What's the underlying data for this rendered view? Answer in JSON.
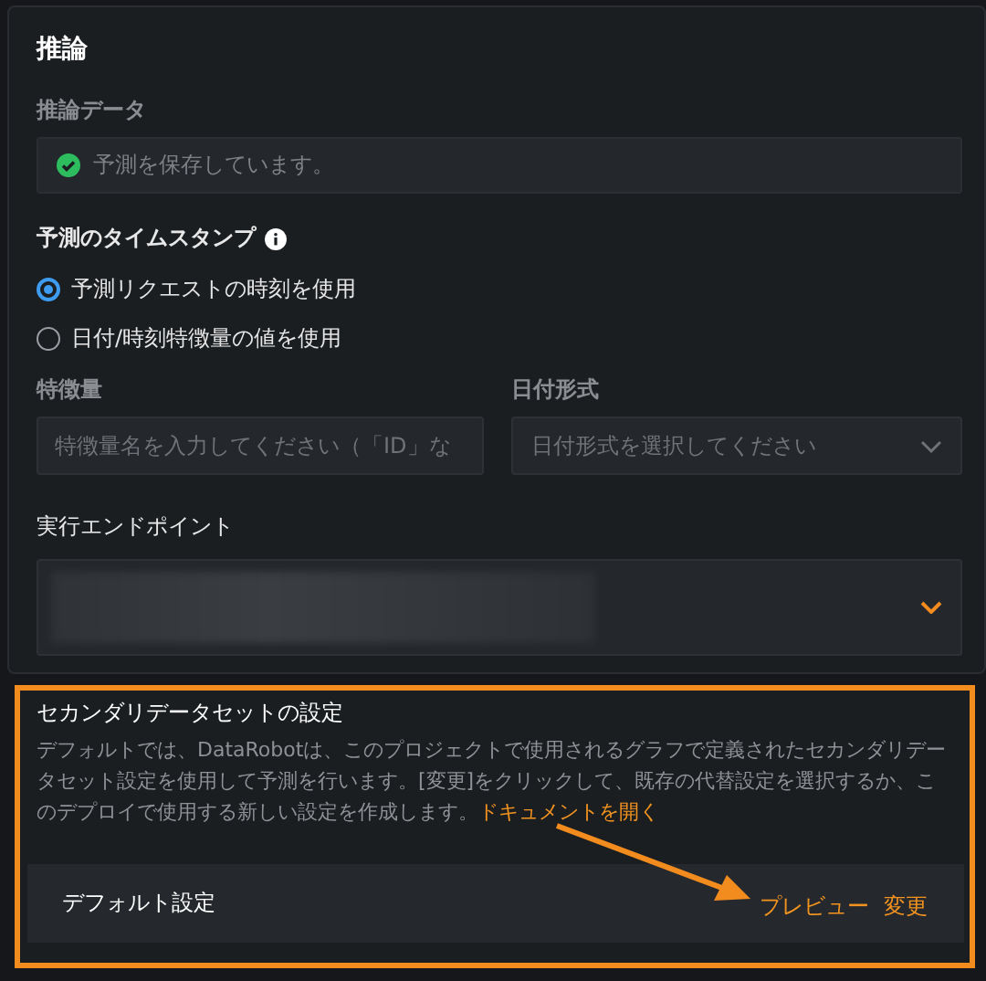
{
  "title": "推論",
  "inference_data": {
    "label": "推論データ",
    "status": "予測を保存しています。",
    "saved": true
  },
  "timestamp": {
    "label": "予測のタイムスタンプ",
    "options": [
      {
        "label": "予測リクエストの時刻を使用",
        "selected": true
      },
      {
        "label": "日付/時刻特徴量の値を使用",
        "selected": false
      }
    ]
  },
  "feature": {
    "label": "特徴量",
    "placeholder": "特徴量名を入力してください（「ID」な"
  },
  "date_format": {
    "label": "日付形式",
    "placeholder": "日付形式を選択してください"
  },
  "endpoint": {
    "label": "実行エンドポイント"
  },
  "secondary": {
    "title": "セカンダリデータセットの設定",
    "description": "デフォルトでは、DataRobotは、このプロジェクトで使用されるグラフで定義されたセカンダリデータセット設定を使用して予測を行います。[変更]をクリックして、既存の代替設定を選択するか、このデプロイで使用する新しい設定を作成します。",
    "doc_link": "ドキュメントを開く",
    "current": "デフォルト設定",
    "actions": [
      "プレビュー",
      "変更"
    ]
  }
}
